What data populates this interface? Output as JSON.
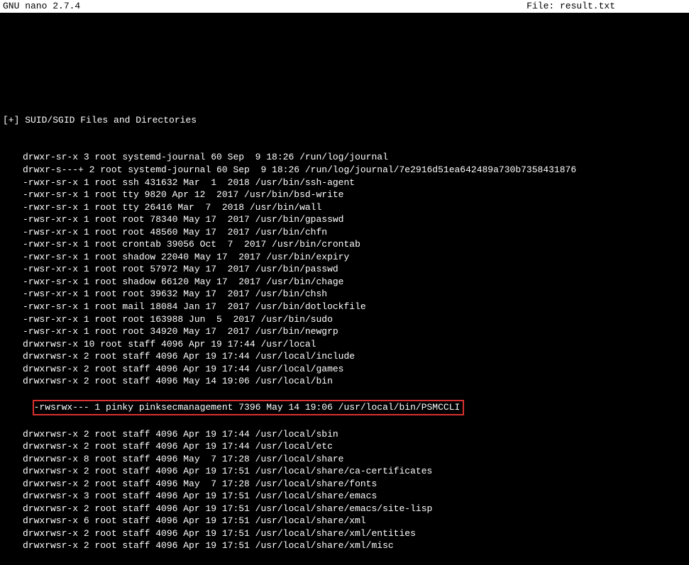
{
  "titlebar": {
    "app": "  GNU nano 2.7.4",
    "file": "File: result.txt"
  },
  "header": "[+] SUID/SGID Files and Directories",
  "lines": [
    "drwxr-sr-x 3 root systemd-journal 60 Sep  9 18:26 /run/log/journal",
    "drwxr-s---+ 2 root systemd-journal 60 Sep  9 18:26 /run/log/journal/7e2916d51ea642489a730b7358431876",
    "-rwxr-sr-x 1 root ssh 431632 Mar  1  2018 /usr/bin/ssh-agent",
    "-rwxr-sr-x 1 root tty 9820 Apr 12  2017 /usr/bin/bsd-write",
    "-rwxr-sr-x 1 root tty 26416 Mar  7  2018 /usr/bin/wall",
    "-rwsr-xr-x 1 root root 78340 May 17  2017 /usr/bin/gpasswd",
    "-rwsr-xr-x 1 root root 48560 May 17  2017 /usr/bin/chfn",
    "-rwxr-sr-x 1 root crontab 39056 Oct  7  2017 /usr/bin/crontab",
    "-rwxr-sr-x 1 root shadow 22040 May 17  2017 /usr/bin/expiry",
    "-rwsr-xr-x 1 root root 57972 May 17  2017 /usr/bin/passwd",
    "-rwxr-sr-x 1 root shadow 66120 May 17  2017 /usr/bin/chage",
    "-rwsr-xr-x 1 root root 39632 May 17  2017 /usr/bin/chsh",
    "-rwxr-sr-x 1 root mail 18084 Jan 17  2017 /usr/bin/dotlockfile",
    "-rwsr-xr-x 1 root root 163988 Jun  5  2017 /usr/bin/sudo",
    "-rwsr-xr-x 1 root root 34920 May 17  2017 /usr/bin/newgrp",
    "drwxrwsr-x 10 root staff 4096 Apr 19 17:44 /usr/local",
    "drwxrwsr-x 2 root staff 4096 Apr 19 17:44 /usr/local/include",
    "drwxrwsr-x 2 root staff 4096 Apr 19 17:44 /usr/local/games",
    "drwxrwsr-x 2 root staff 4096 May 14 19:06 /usr/local/bin"
  ],
  "highlighted_line": "-rwsrwx--- 1 pinky pinksecmanagement 7396 May 14 19:06 /usr/local/bin/PSMCCLI",
  "lines_after": [
    "drwxrwsr-x 2 root staff 4096 Apr 19 17:44 /usr/local/sbin",
    "drwxrwsr-x 2 root staff 4096 Apr 19 17:44 /usr/local/etc",
    "drwxrwsr-x 8 root staff 4096 May  7 17:28 /usr/local/share",
    "drwxrwsr-x 2 root staff 4096 Apr 19 17:51 /usr/local/share/ca-certificates",
    "drwxrwsr-x 2 root staff 4096 May  7 17:28 /usr/local/share/fonts",
    "drwxrwsr-x 3 root staff 4096 Apr 19 17:51 /usr/local/share/emacs",
    "drwxrwsr-x 2 root staff 4096 Apr 19 17:51 /usr/local/share/emacs/site-lisp",
    "drwxrwsr-x 6 root staff 4096 Apr 19 17:51 /usr/local/share/xml",
    "drwxrwsr-x 2 root staff 4096 Apr 19 17:51 /usr/local/share/xml/entities",
    "drwxrwsr-x 2 root staff 4096 Apr 19 17:51 /usr/local/share/xml/misc"
  ]
}
